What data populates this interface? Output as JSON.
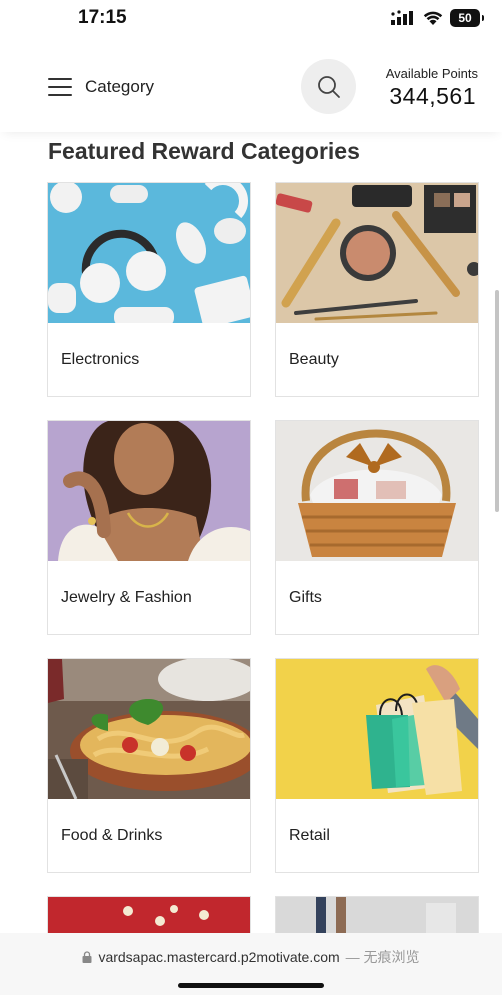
{
  "status_bar": {
    "time": "17:15",
    "battery": "50",
    "icons": [
      "signal-icon",
      "wifi-icon",
      "battery-icon"
    ]
  },
  "header": {
    "menu_label": "Category",
    "search_icon": "search-icon",
    "points_label": "Available Points",
    "points_value": "344,561"
  },
  "section": {
    "title": "Featured Reward Categories"
  },
  "categories": [
    {
      "label": "Electronics",
      "image": "electronics-image"
    },
    {
      "label": "Beauty",
      "image": "beauty-image"
    },
    {
      "label": "Jewelry & Fashion",
      "image": "jewelry-image"
    },
    {
      "label": "Gifts",
      "image": "gifts-image"
    },
    {
      "label": "Food & Drinks",
      "image": "food-image"
    },
    {
      "label": "Retail",
      "image": "retail-image"
    }
  ],
  "browser": {
    "url": "vardsapac.mastercard.p2motivate.com",
    "suffix": "— 无痕浏览"
  }
}
